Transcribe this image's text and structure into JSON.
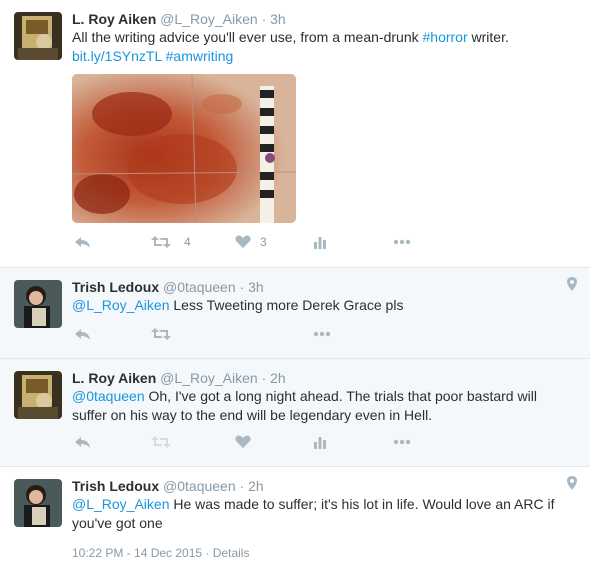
{
  "tweets": [
    {
      "name": "L. Roy Aiken",
      "handle": "@L_Roy_Aiken",
      "sep": "·",
      "time": "3h",
      "text_1": "All the writing advice you'll ever use, from a mean-drunk ",
      "hashtag_1": "#horror",
      "text_2": " writer.",
      "link": "bit.ly/1SYnzTL",
      "hashtag_2": "#amwriting",
      "retweets": "4",
      "likes": "3"
    },
    {
      "name": "Trish Ledoux",
      "handle": "@0taqueen",
      "sep": "·",
      "time": "3h",
      "mention": "@L_Roy_Aiken",
      "text": " Less Tweeting more Derek Grace pls"
    },
    {
      "name": "L. Roy Aiken",
      "handle": "@L_Roy_Aiken",
      "sep": "·",
      "time": "2h",
      "mention": "@0taqueen",
      "text": " Oh, I've got a long night ahead. The trials that poor bastard will suffer on his way to the end will be legendary even in Hell."
    },
    {
      "name": "Trish Ledoux",
      "handle": "@0taqueen",
      "sep": "·",
      "time": "2h",
      "mention": "@L_Roy_Aiken",
      "text": " He was made to suffer; it's his lot in life. Would love an ARC if you've got one",
      "timestamp": "10:22 PM - 14 Dec 2015",
      "details_sep": "·",
      "details": "Details"
    }
  ],
  "icons": {
    "reply": "reply-icon",
    "retweet": "retweet-icon",
    "like": "heart-icon",
    "analytics": "analytics-icon",
    "more": "more-icon",
    "location": "location-pin-icon"
  },
  "colors": {
    "link": "#1b95e0",
    "muted": "#8899a6",
    "icon": "#aab8c2",
    "reply_bg": "#f5f8fa"
  }
}
